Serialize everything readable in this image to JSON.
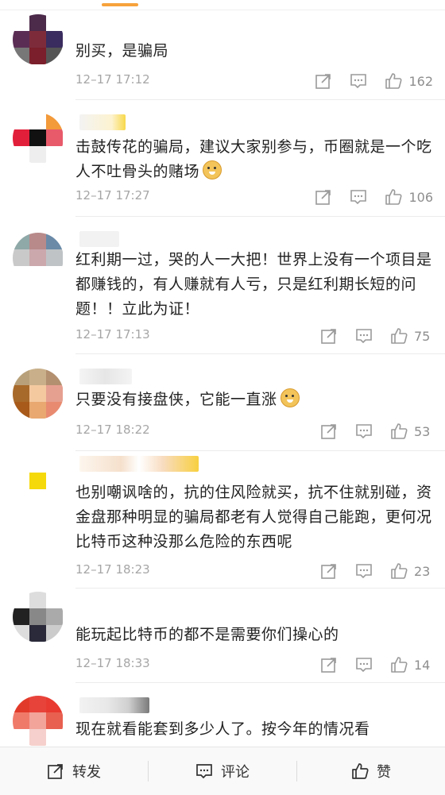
{
  "comments": [
    {
      "text": "别买，是骗局",
      "time": "12–17 17:12",
      "likes": "162",
      "has_emoji": false
    },
    {
      "text": "击鼓传花的骗局，建议大家别参与，币圈就是一个吃人不吐骨头的赌场",
      "time": "12–17 17:27",
      "likes": "106",
      "has_emoji": true
    },
    {
      "text": "红利期一过，哭的人一大把！世界上没有一个项目是都赚钱的，有人赚就有人亏，只是红利期长短的问题！！立此为证！",
      "time": "12–17 17:13",
      "likes": "75",
      "has_emoji": false
    },
    {
      "text": "只要没有接盘侠，它能一直涨",
      "time": "12–17 18:22",
      "likes": "53",
      "has_emoji": true
    },
    {
      "text": "也别嘲讽啥的，抗的住风险就买，抗不住就别碰，资金盘那种明显的骗局都老有人觉得自己能跑，更何况比特币这种没那么危险的东西呢",
      "time": "12–17 18:23",
      "likes": "23",
      "has_emoji": false
    },
    {
      "text": "能玩起比特币的都不是需要你们操心的",
      "time": "12–17 18:33",
      "likes": "14",
      "has_emoji": false
    },
    {
      "text": "现在就看能套到多少人了。按今年的情况看",
      "time": "",
      "likes": "",
      "has_emoji": false
    }
  ],
  "bottom_bar": {
    "repost": "转发",
    "comment": "评论",
    "like": "赞"
  },
  "colors": {
    "accent": "#f7a23b",
    "time": "#a6a6a6",
    "icon": "#9a9a9a"
  },
  "icons": {
    "repost": "share-icon",
    "comment": "comment-icon",
    "like": "thumbs-up-icon"
  }
}
